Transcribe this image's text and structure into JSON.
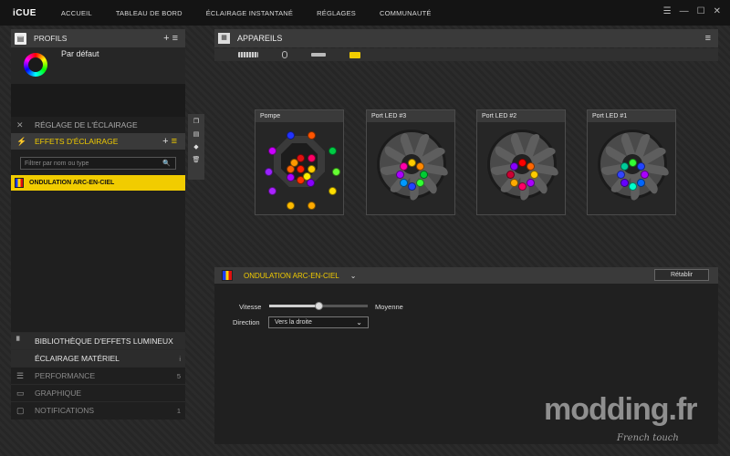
{
  "app": {
    "logo": "iCUE"
  },
  "nav": [
    "ACCUEIL",
    "TABLEAU DE BORD",
    "ÉCLAIRAGE INSTANTANÉ",
    "RÉGLAGES",
    "COMMUNAUTÉ"
  ],
  "window_controls": {
    "menu": "☰",
    "min": "—",
    "max": "☐",
    "close": "✕"
  },
  "profiles": {
    "title": "PROFILS",
    "add": "+",
    "menu": "≡",
    "profile_name": "Par défaut"
  },
  "lighting": {
    "setup_label": "RÉGLAGE DE L'ÉCLAIRAGE",
    "effects_label": "EFFETS D'ÉCLAIRAGE",
    "add": "+",
    "menu": "≡"
  },
  "filter": {
    "placeholder": "Filtrer par nom ou type"
  },
  "effect_item": "ONDULATION ARC-EN-CIEL",
  "bottom_nav": [
    {
      "label": "BIBLIOTHÈQUE D'EFFETS LUMINEUX",
      "count": ""
    },
    {
      "label": "ÉCLAIRAGE MATÉRIEL",
      "count": "i"
    },
    {
      "label": "PERFORMANCE",
      "count": "5"
    },
    {
      "label": "GRAPHIQUE",
      "count": ""
    },
    {
      "label": "NOTIFICATIONS",
      "count": "1"
    }
  ],
  "devices": {
    "title": "APPAREILS"
  },
  "cards": [
    {
      "title": "Pompe"
    },
    {
      "title": "Port LED #3"
    },
    {
      "title": "Port LED #2"
    },
    {
      "title": "Port LED #1"
    }
  ],
  "effect_panel": {
    "name": "ONDULATION ARC-EN-CIEL",
    "reset": "Rétablir",
    "speed_label": "Vitesse",
    "speed_value": "Moyenne",
    "speed_level": 0.5,
    "direction_label": "Direction",
    "direction_value": "Vers la droite"
  },
  "watermark": {
    "main": "modding.fr",
    "sub": "French touch"
  }
}
